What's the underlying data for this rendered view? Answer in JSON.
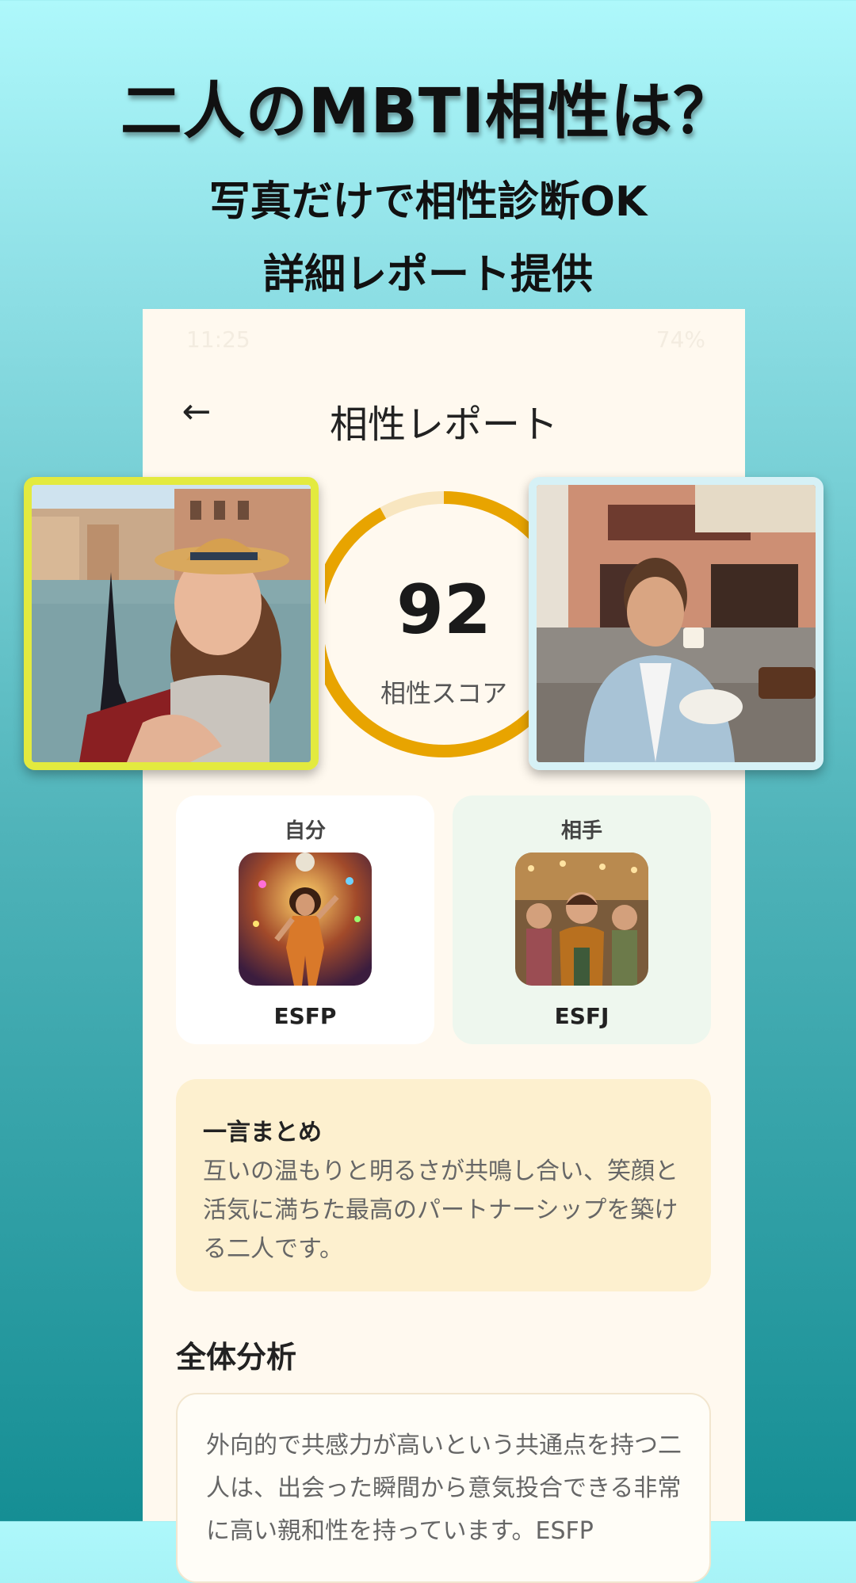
{
  "promo": {
    "title": "二人のMBTI相性は？",
    "subtitle_line1": "写真だけで相性診断OK",
    "subtitle_line2": "詳細レポート提供"
  },
  "status_bar": {
    "time": "11:25",
    "battery": "74%"
  },
  "app_bar": {
    "back_icon": "arrow-left-icon",
    "title": "相性レポート"
  },
  "score": {
    "value": "92",
    "label": "相性スコア",
    "progress_fraction": 0.92,
    "ring_color": "#e8a400",
    "track_color": "#f8e6c0"
  },
  "profiles": {
    "self": {
      "label": "自分",
      "type": "ESFP",
      "frame_color": "#e3ea3f"
    },
    "partner": {
      "label": "相手",
      "type": "ESFJ",
      "frame_color": "#d6f1f6"
    }
  },
  "summary": {
    "title": "一言まとめ",
    "text": "互いの温もりと明るさが共鳴し合い、笑顔と活気に満ちた最高のパートナーシップを築ける二人です。"
  },
  "analysis": {
    "title": "全体分析",
    "text": "外向的で共感力が高いという共通点を持つ二人は、出会った瞬間から意気投合できる非常に高い親和性を持っています。ESFP"
  }
}
